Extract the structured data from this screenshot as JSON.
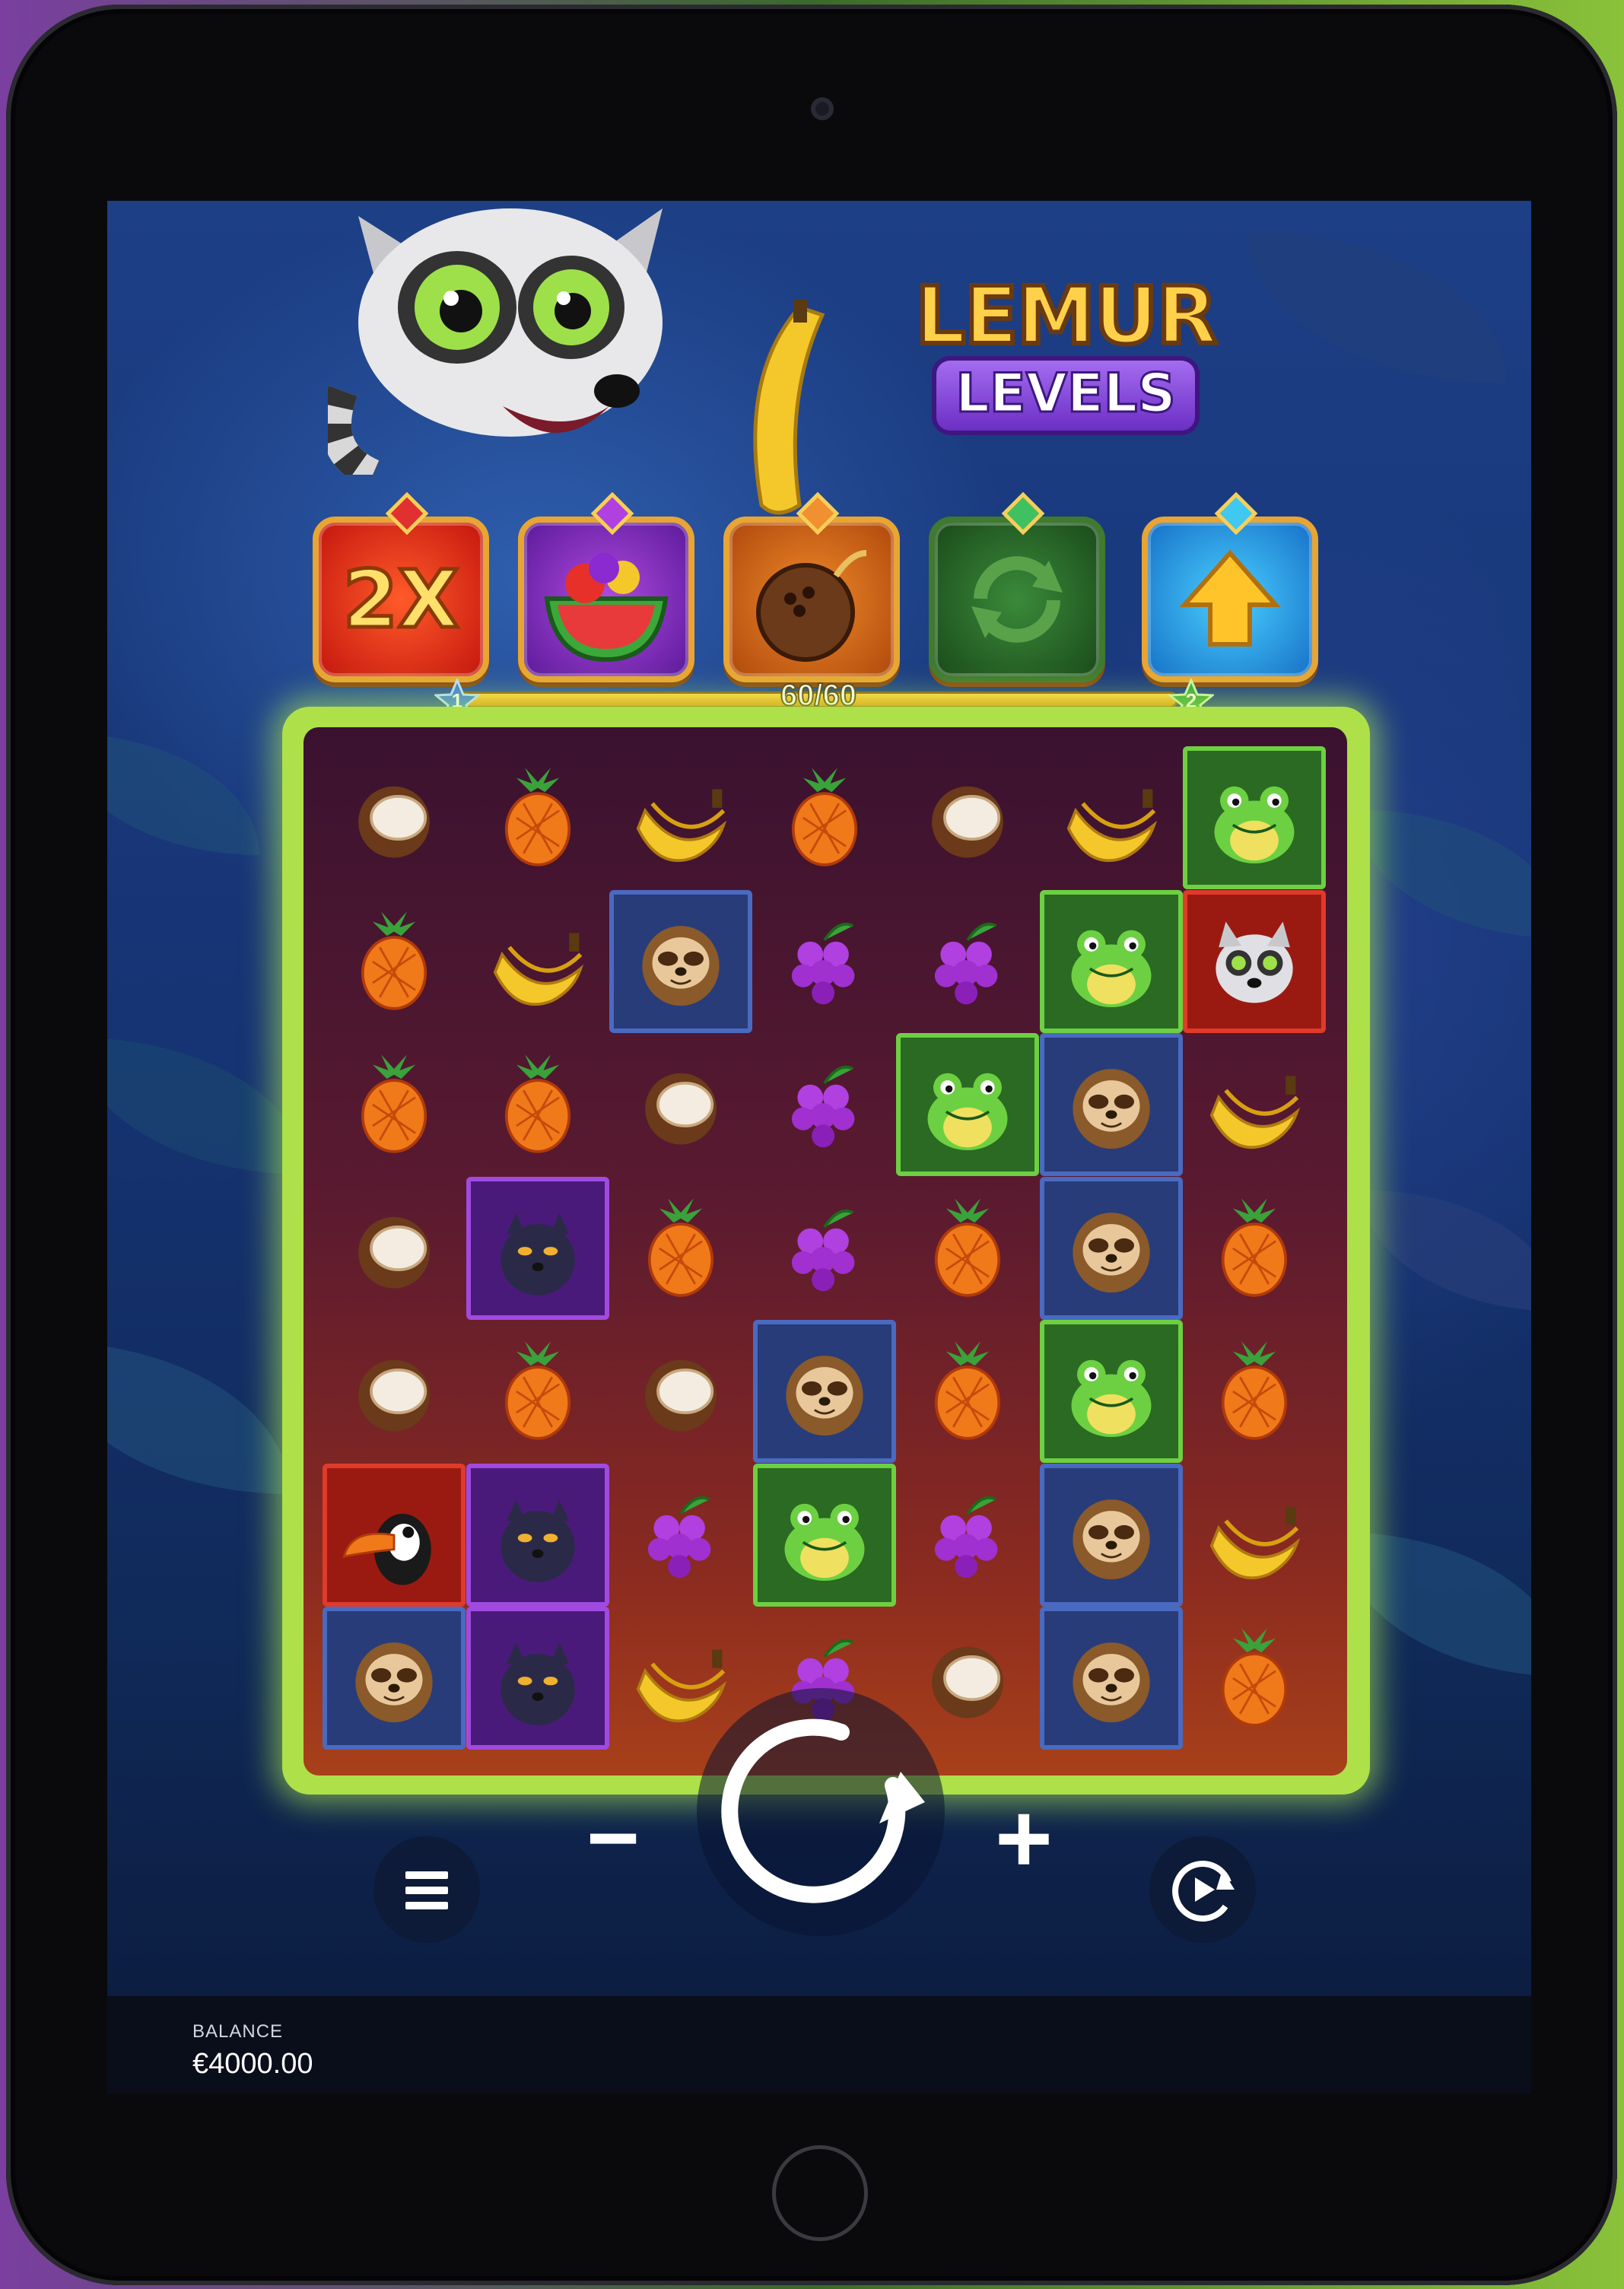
{
  "game": {
    "logo_top": "LEMUR",
    "logo_bottom": "LEVELS"
  },
  "features": [
    {
      "id": "multiplier",
      "label": "2X",
      "gem_color": "#e03030"
    },
    {
      "id": "fruit-bowl",
      "label": "",
      "gem_color": "#b040e0"
    },
    {
      "id": "coconut-bomb",
      "label": "",
      "gem_color": "#f09030"
    },
    {
      "id": "reshuffle",
      "label": "",
      "gem_color": "#40c060"
    },
    {
      "id": "level-up",
      "label": "",
      "gem_color": "#40c8f0"
    }
  ],
  "progress": {
    "text": "60/60",
    "fraction": 1.0,
    "level_start": "1",
    "level_end": "2"
  },
  "grid": [
    [
      "coconut",
      "pineapple",
      "banana",
      "pineapple",
      "coconut",
      "banana",
      "frog"
    ],
    [
      "pineapple",
      "banana",
      "sloth",
      "grapes",
      "grapes",
      "frog",
      "lemur"
    ],
    [
      "pineapple",
      "pineapple",
      "coconut",
      "grapes",
      "frog",
      "sloth",
      "banana"
    ],
    [
      "coconut",
      "panther",
      "pineapple",
      "grapes",
      "pineapple",
      "sloth",
      "pineapple"
    ],
    [
      "coconut",
      "pineapple",
      "coconut",
      "sloth",
      "pineapple",
      "frog",
      "pineapple"
    ],
    [
      "toucan",
      "panther",
      "grapes",
      "frog",
      "grapes",
      "sloth",
      "banana"
    ],
    [
      "sloth",
      "panther",
      "banana",
      "grapes",
      "coconut",
      "sloth",
      "pineapple"
    ]
  ],
  "controls": {
    "menu": "menu-icon",
    "minus": "−",
    "plus": "+",
    "spin": "spin-icon",
    "autoplay": "autoplay-icon"
  },
  "footer": {
    "balance_label": "BALANCE",
    "balance_value": "€4000.00"
  },
  "colors": {
    "board_glow": "#aee04a",
    "frame_gold": "#e8a533"
  }
}
